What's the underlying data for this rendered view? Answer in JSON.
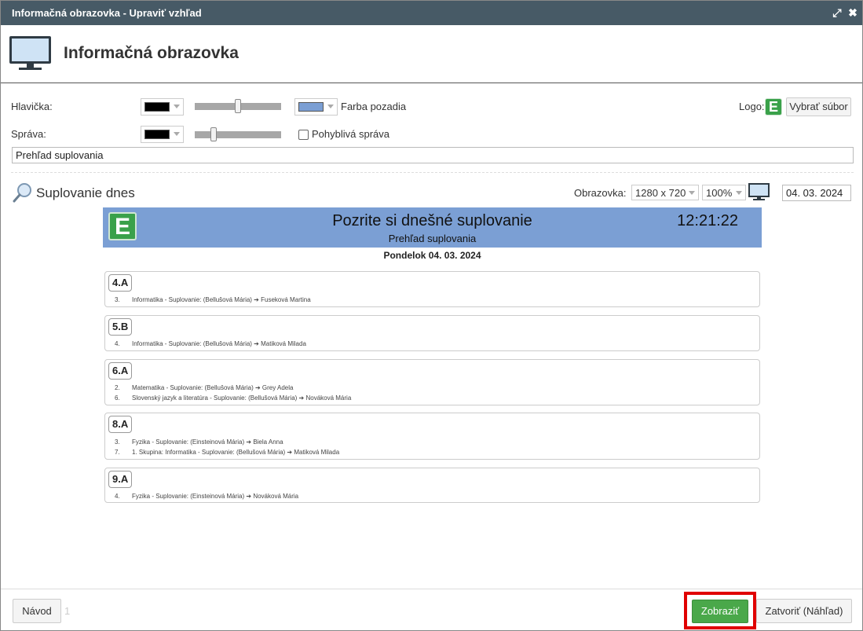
{
  "window": {
    "title": "Informačná obrazovka - Upraviť vzhľad",
    "expand_glyph": "⤢",
    "close_glyph": "✖"
  },
  "header": {
    "title": "Informačná obrazovka"
  },
  "settings": {
    "header_label": "Hlavička:",
    "header_text_color": "#000000",
    "header_slider_level": 0.5,
    "bg_color": "#7b9fd4",
    "bg_color_label": "Farba pozadia",
    "message_label": "Správa:",
    "message_color": "#000000",
    "message_slider_level": 0.2,
    "moving_message_label": "Pohyblivá správa",
    "moving_message_checked": false,
    "logo_label": "Logo:",
    "choose_file_label": "Vybrať súbor",
    "message_text": "Prehľad suplovania"
  },
  "section": {
    "title": "Suplovanie dnes",
    "screen_label": "Obrazovka:",
    "resolution": "1280 x 720",
    "zoom": "100%",
    "date": "04. 03. 2024"
  },
  "preview": {
    "logo_letter": "E",
    "title": "Pozrite si dnešné suplovanie",
    "subtitle": "Prehľad suplovania",
    "time": "12:21:22",
    "date_line": "Pondelok 04. 03. 2024",
    "classes": [
      {
        "name": "4.A",
        "rows": [
          {
            "num": "3.",
            "text": "Informatika - Suplovanie: (Bellušová Mária) ➔ Fuseková Martina"
          }
        ]
      },
      {
        "name": "5.B",
        "rows": [
          {
            "num": "4.",
            "text": "Informatika - Suplovanie: (Bellušová Mária) ➔ Matiková Milada"
          }
        ]
      },
      {
        "name": "6.A",
        "rows": [
          {
            "num": "2.",
            "text": "Matematika - Suplovanie: (Bellušová Mária) ➔ Grey Adela"
          },
          {
            "num": "6.",
            "text": "Slovenský jazyk a literatúra - Suplovanie: (Bellušová Mária) ➔ Nováková Mária"
          }
        ]
      },
      {
        "name": "8.A",
        "rows": [
          {
            "num": "3.",
            "text": "Fyzika - Suplovanie: (Einsteinová Mária) ➔ Biela Anna"
          },
          {
            "num": "7.",
            "text": "1. Skupina: Informatika - Suplovanie: (Bellušová Mária) ➔ Matiková Milada"
          }
        ]
      },
      {
        "name": "9.A",
        "rows": [
          {
            "num": "4.",
            "text": "Fyzika - Suplovanie: (Einsteinová Mária) ➔ Nováková Mária"
          }
        ]
      }
    ]
  },
  "footer": {
    "help_label": "Návod",
    "page_number": "1",
    "show_label": "Zobraziť",
    "close_preview_label": "Zatvoriť (Náhľad)"
  },
  "colors": {
    "titlebar": "#475a66",
    "accent_green": "#4aa84a",
    "highlight": "#e00000"
  }
}
